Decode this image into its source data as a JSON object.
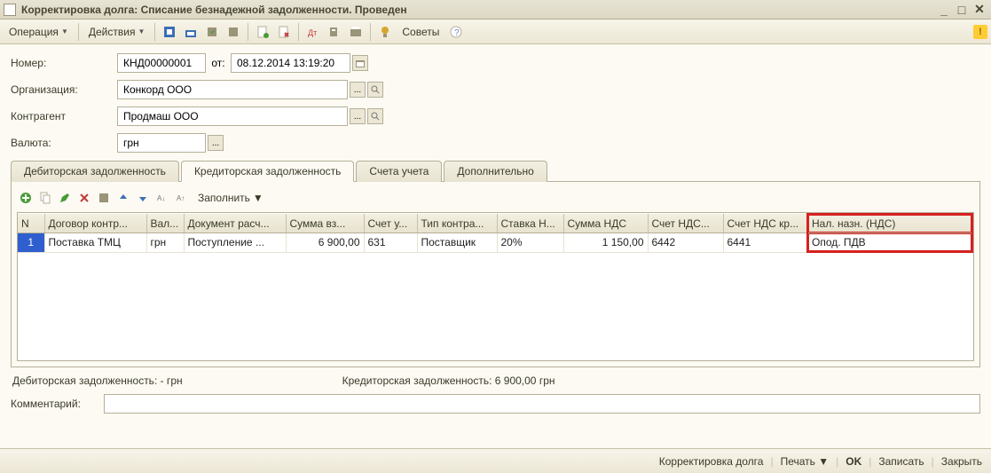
{
  "window": {
    "title": "Корректировка долга: Списание безнадежной задолженности. Проведен"
  },
  "menu": {
    "operation": "Операция",
    "actions": "Действия",
    "sovety": "Советы"
  },
  "header": {
    "nomer_label": "Номер:",
    "nomer_value": "КНД00000001",
    "ot_label": "от:",
    "ot_value": "08.12.2014 13:19:20",
    "org_label": "Организация:",
    "org_value": "Конкорд ООО",
    "contr_label": "Контрагент",
    "contr_value": "Продмаш ООО",
    "val_label": "Валюта:",
    "val_value": "грн"
  },
  "tabs": {
    "t1": "Дебиторская задолженность",
    "t2": "Кредиторская задолженность",
    "t3": "Счета учета",
    "t4": "Дополнительно"
  },
  "grid_toolbar": {
    "zapolnit": "Заполнить"
  },
  "grid": {
    "cols": {
      "n": "N",
      "dogovor": "Договор контр...",
      "val": "Вал...",
      "docras": "Документ расч...",
      "summa_vz": "Сумма вз...",
      "schet_u": "Счет у...",
      "tip_kontra": "Тип контра...",
      "stavka": "Ставка Н...",
      "summa_nds": "Сумма НДС",
      "schet_nds": "Счет  НДС...",
      "schet_nds_kr": "Счет  НДС кр...",
      "nal_nazn": "Нал. назн. (НДС)"
    },
    "row": {
      "n": "1",
      "dogovor": "Поставка ТМЦ",
      "val": "грн",
      "docras": "Поступление ...",
      "summa_vz": "6 900,00",
      "schet_u": "631",
      "tip_kontra": "Поставщик",
      "stavka": "20%",
      "summa_nds": "1 150,00",
      "schet_nds": "6442",
      "schet_nds_kr": "6441",
      "nal_nazn": "Опод. ПДВ"
    }
  },
  "summary": {
    "debit": "Дебиторская задолженность: - грн",
    "kredit": "Кредиторская задолженность: 6 900,00 грн"
  },
  "comment_label": "Комментарий:",
  "footer": {
    "korr": "Корректировка долга",
    "pechat": "Печать",
    "ok": "OK",
    "zapisat": "Записать",
    "zakryt": "Закрыть"
  }
}
